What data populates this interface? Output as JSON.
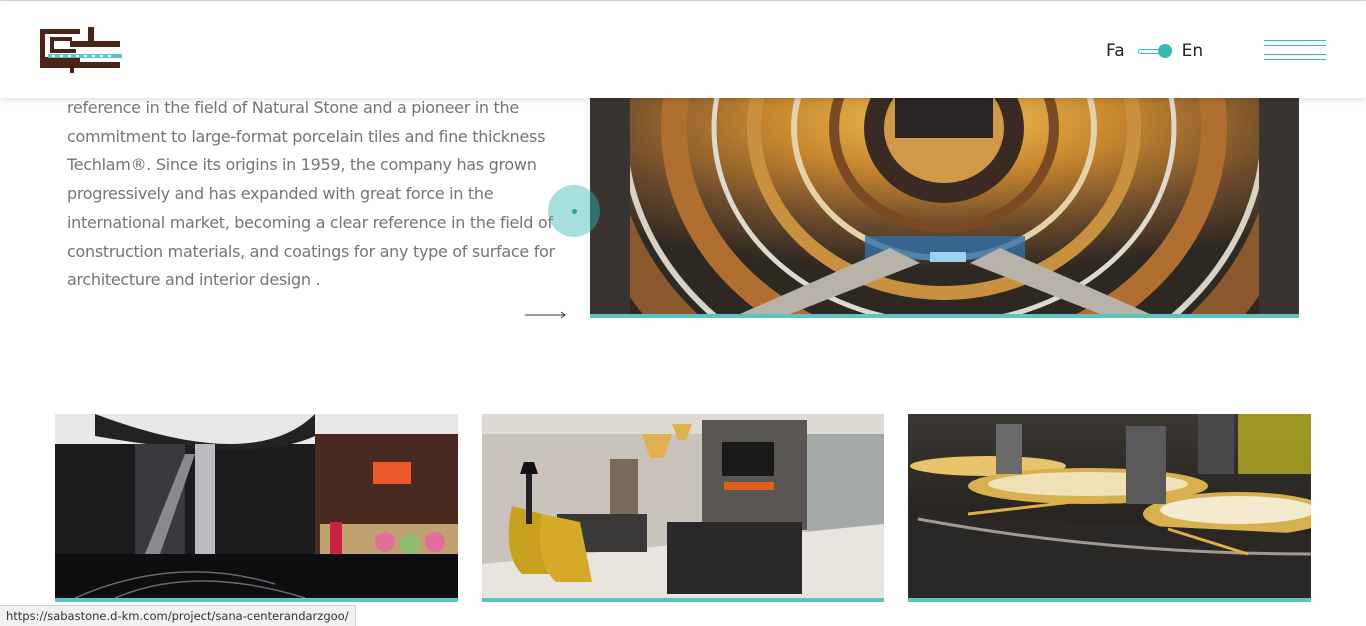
{
  "header": {
    "lang_fa": "Fa",
    "lang_en": "En",
    "selected_language": "En",
    "logo_icon": "company-logo",
    "menu_icon": "hamburger-menu-icon"
  },
  "intro": {
    "text": "reference in the field of Natural Stone and a pioneer in the commitment to large-format porcelain tiles and fine thickness Techlam®. Since its origins in 1959, the company has grown progressively and has expanded with great force in the international market, becoming a clear reference in the field of construction materials, and coatings for any type of surface for architecture and interior design .",
    "arrow_icon": "arrow-right-icon"
  },
  "hero": {
    "image": "mall-atrium-aerial-photo"
  },
  "projects": [
    {
      "image": "shopping-mall-escalator-photo"
    },
    {
      "image": "hotel-lobby-lounge-photo"
    },
    {
      "image": "dining-table-setting-photo"
    }
  ],
  "status_bar": {
    "url": "https://sabastone.d-km.com/project/sana-centerandarzgoo/"
  },
  "colors": {
    "accent": "#39b7b2",
    "accent_bar": "#5ec3c0",
    "text": "#757575",
    "logo": "#4a2418"
  }
}
